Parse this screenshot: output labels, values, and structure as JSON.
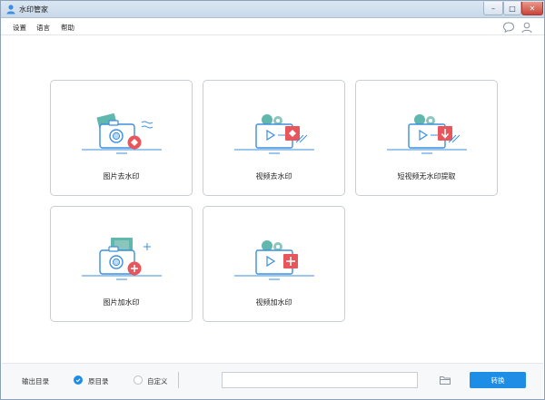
{
  "window": {
    "title": "水印管家"
  },
  "menu": {
    "settings": "设置",
    "language": "语言",
    "help": "帮助"
  },
  "cards": [
    {
      "label": "图片去水印",
      "icon": "photo-remove-watermark-icon"
    },
    {
      "label": "视频去水印",
      "icon": "video-remove-watermark-icon"
    },
    {
      "label": "短视频无水印提取",
      "icon": "short-video-extract-icon"
    },
    {
      "label": "图片加水印",
      "icon": "photo-add-watermark-icon"
    },
    {
      "label": "视频加水印",
      "icon": "video-add-watermark-icon"
    }
  ],
  "bottom": {
    "output_label": "输出目录",
    "option_original": "原目录",
    "option_custom": "自定义",
    "selected": "原目录",
    "path_value": "",
    "convert_label": "转换"
  },
  "colors": {
    "accent": "#1e8de6",
    "badge_red": "#e8555b",
    "line_blue": "#3d8fdd",
    "teal": "#5fb7ad"
  }
}
